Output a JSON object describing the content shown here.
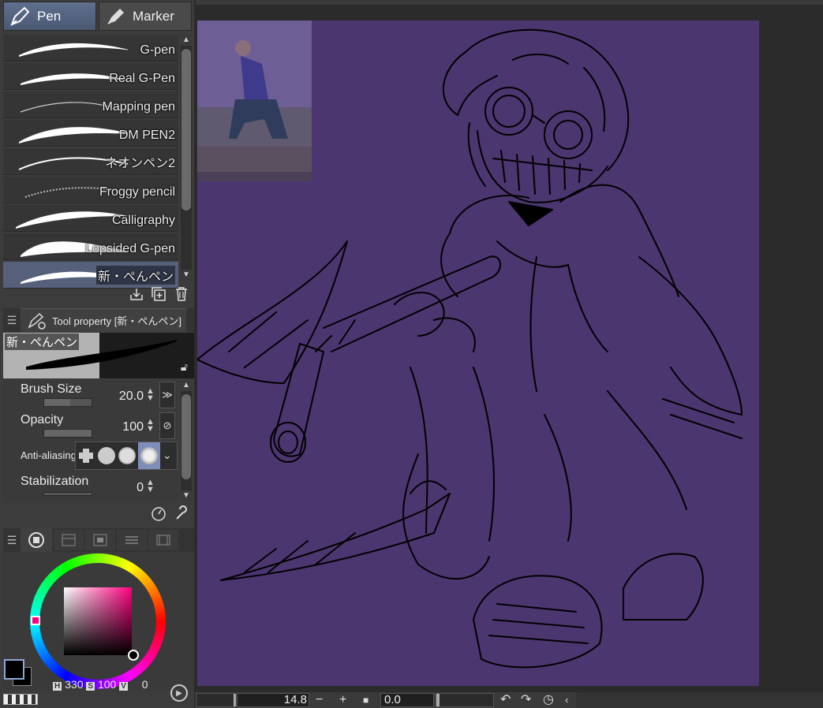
{
  "tabs": {
    "pen": "Pen",
    "marker": "Marker"
  },
  "brushes": [
    {
      "name": "G-pen"
    },
    {
      "name": "Real G-Pen"
    },
    {
      "name": "Mapping pen"
    },
    {
      "name": "DM PEN2"
    },
    {
      "name": "ネオンペン2"
    },
    {
      "name": "Froggy pencil"
    },
    {
      "name": "Calligraphy"
    },
    {
      "name": "Lopsided G-pen"
    },
    {
      "name": "新・ぺんペン"
    }
  ],
  "tool_property": {
    "title": "Tool property [新・ぺんペン]",
    "preview_label": "新・ぺんペン",
    "brush_size_label": "Brush Size",
    "brush_size_value": "20.0",
    "opacity_label": "Opacity",
    "opacity_value": "100",
    "antialiasing_label": "Anti-aliasing",
    "stabilization_label": "Stabilization",
    "stabilization_value": "0"
  },
  "color": {
    "main": "#000000",
    "sub": "#000000",
    "h_label": "H",
    "h_value": "330",
    "s_label": "S",
    "s_value": "100",
    "v_label": "V",
    "v_value": "0",
    "canvas_bg": "#4b3670"
  },
  "bottom": {
    "zoom_value": "14.8",
    "minus": "−",
    "plus": "+",
    "angle_value": "0.0"
  }
}
